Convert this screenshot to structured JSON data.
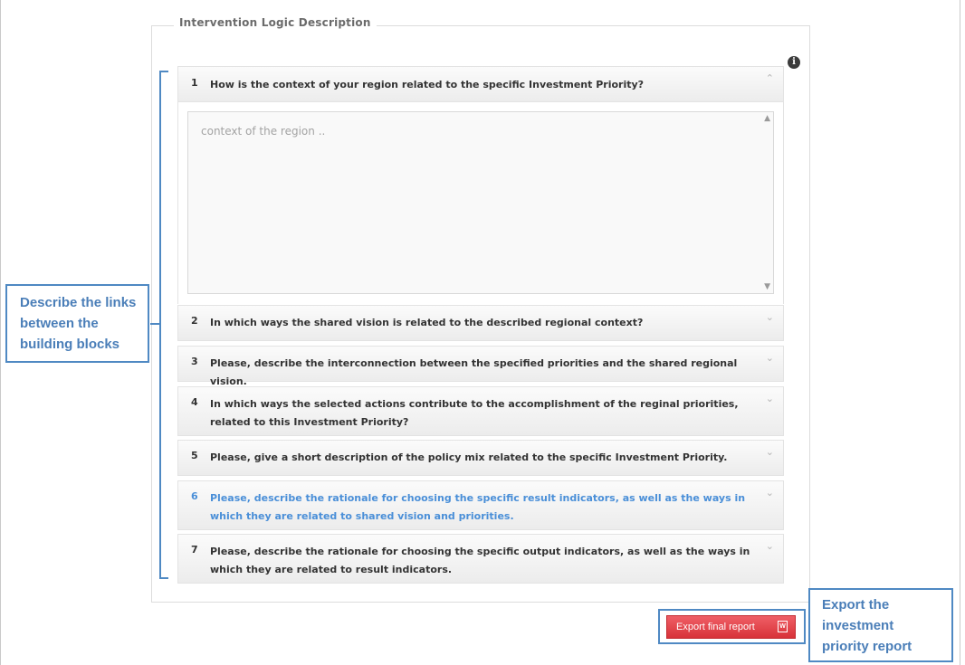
{
  "section": {
    "legend": "Intervention Logic Description",
    "info_icon": "i"
  },
  "questions": [
    {
      "num": "1",
      "text": "How is the context of your region related to the specific Investment Priority?",
      "expanded": true
    },
    {
      "num": "2",
      "text": "In which ways the shared vision is related to the described regional context?",
      "expanded": false
    },
    {
      "num": "3",
      "text": "Please, describe the interconnection between the specified priorities and the shared regional vision.",
      "expanded": false
    },
    {
      "num": "4",
      "text": "In which ways the selected actions contribute to the accomplishment of the reginal priorities, related to this Investment Priority?",
      "expanded": false
    },
    {
      "num": "5",
      "text": "Please, give a short description of the policy mix related to the specific Investment Priority.",
      "expanded": false
    },
    {
      "num": "6",
      "text": "Please, describe the rationale for choosing the specific result indicators, as well as the ways in which they are related to shared vision and priorities.",
      "expanded": false,
      "active": true
    },
    {
      "num": "7",
      "text": "Please, describe the rationale for choosing the specific output indicators, as well as the ways in which they are related to result indicators.",
      "expanded": false
    }
  ],
  "context_input": {
    "placeholder": "context of the region ..",
    "value": ""
  },
  "export_button": {
    "label": "Export final report",
    "icon": "word-doc-icon",
    "color": "#e8454c"
  },
  "annotations": {
    "links_callout": [
      "Describe the links",
      "between the",
      "building blocks"
    ],
    "export_callout": [
      "Export the",
      "investment",
      "priority report"
    ],
    "annotation_color": "#4f89c3"
  },
  "colors": {
    "active_question": "#4a8fd8",
    "annotation_text": "#4a7eb8"
  }
}
